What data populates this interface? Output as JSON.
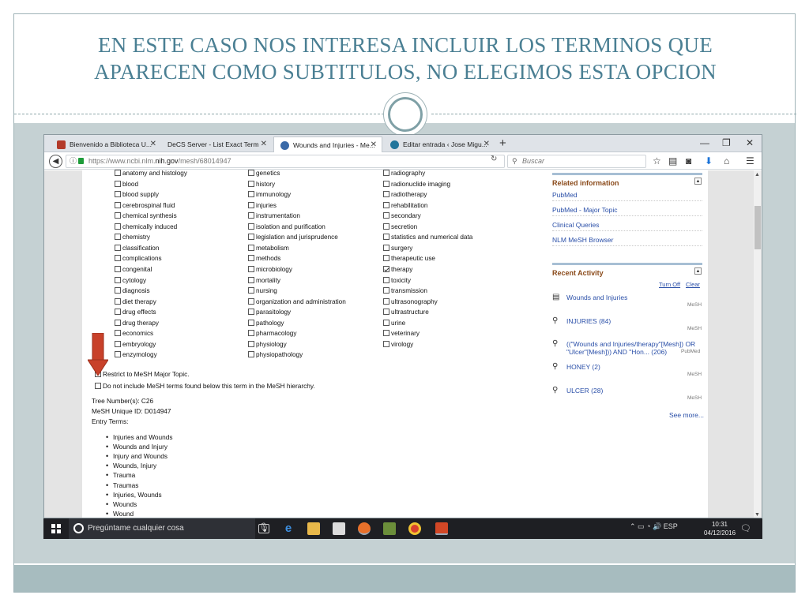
{
  "slide": {
    "title_line1": "EN ESTE CASO NOS INTERESA INCLUIR LOS TERMINOS QUE",
    "title_line2": "APARECEN COMO SUBTITULOS, NO ELEGIMOS ESTA OPCION"
  },
  "browser": {
    "tabs": [
      {
        "label": "Bienvenido a Biblioteca U...",
        "icon": "library-favicon",
        "color": "#b33a2a"
      },
      {
        "label": "DeCS Server - List Exact Term",
        "icon": "decs-favicon",
        "color": "#dfe3e8"
      },
      {
        "label": "Wounds and Injuries - Me...",
        "icon": "ncbi-favicon",
        "color": "#3a6aa8"
      },
      {
        "label": "Editar entrada ‹ Jose Migu...",
        "icon": "wordpress-favicon",
        "color": "#21759b"
      }
    ],
    "new_tab": "+",
    "url_prefix": "https://www.ncbi.nlm.",
    "url_domain": "nih.gov",
    "url_path": "/mesh/68014947",
    "search_placeholder": "Buscar"
  },
  "subheadings": {
    "col1": [
      {
        "label": "anatomy and histology",
        "checked": false
      },
      {
        "label": "blood",
        "checked": false
      },
      {
        "label": "blood supply",
        "checked": false
      },
      {
        "label": "cerebrospinal fluid",
        "checked": false
      },
      {
        "label": "chemical synthesis",
        "checked": false
      },
      {
        "label": "chemically induced",
        "checked": false
      },
      {
        "label": "chemistry",
        "checked": false
      },
      {
        "label": "classification",
        "checked": false
      },
      {
        "label": "complications",
        "checked": false
      },
      {
        "label": "congenital",
        "checked": false
      },
      {
        "label": "cytology",
        "checked": false
      },
      {
        "label": "diagnosis",
        "checked": false
      },
      {
        "label": "diet therapy",
        "checked": false
      },
      {
        "label": "drug effects",
        "checked": false
      },
      {
        "label": "drug therapy",
        "checked": false
      },
      {
        "label": "economics",
        "checked": false
      },
      {
        "label": "embryology",
        "checked": false
      },
      {
        "label": "enzymology",
        "checked": false
      }
    ],
    "col2": [
      {
        "label": "genetics",
        "checked": false
      },
      {
        "label": "history",
        "checked": false
      },
      {
        "label": "immunology",
        "checked": false
      },
      {
        "label": "injuries",
        "checked": false
      },
      {
        "label": "instrumentation",
        "checked": false
      },
      {
        "label": "isolation and purification",
        "checked": false
      },
      {
        "label": "legislation and jurisprudence",
        "checked": false
      },
      {
        "label": "metabolism",
        "checked": false
      },
      {
        "label": "methods",
        "checked": false
      },
      {
        "label": "microbiology",
        "checked": false
      },
      {
        "label": "mortality",
        "checked": false
      },
      {
        "label": "nursing",
        "checked": false
      },
      {
        "label": "organization and administration",
        "checked": false
      },
      {
        "label": "parasitology",
        "checked": false
      },
      {
        "label": "pathology",
        "checked": false
      },
      {
        "label": "pharmacology",
        "checked": false
      },
      {
        "label": "physiology",
        "checked": false
      },
      {
        "label": "physiopathology",
        "checked": false
      }
    ],
    "col3": [
      {
        "label": "radiography",
        "checked": false
      },
      {
        "label": "radionuclide imaging",
        "checked": false
      },
      {
        "label": "radiotherapy",
        "checked": false
      },
      {
        "label": "rehabilitation",
        "checked": false
      },
      {
        "label": "secondary",
        "checked": false
      },
      {
        "label": "secretion",
        "checked": false
      },
      {
        "label": "statistics and numerical data",
        "checked": false
      },
      {
        "label": "surgery",
        "checked": false
      },
      {
        "label": "therapeutic use",
        "checked": false
      },
      {
        "label": "therapy",
        "checked": true
      },
      {
        "label": "toxicity",
        "checked": false
      },
      {
        "label": "transmission",
        "checked": false
      },
      {
        "label": "ultrasonography",
        "checked": false
      },
      {
        "label": "ultrastructure",
        "checked": false
      },
      {
        "label": "urine",
        "checked": false
      },
      {
        "label": "veterinary",
        "checked": false
      },
      {
        "label": "virology",
        "checked": false
      }
    ]
  },
  "options": {
    "restrict_major": "Restrict to MeSH Major Topic.",
    "do_not_include": "Do not include MeSH terms found below this term in the MeSH hierarchy."
  },
  "term_info": {
    "tree_number": "Tree Number(s): C26",
    "unique_id": "MeSH Unique ID: D014947",
    "entry_terms_label": "Entry Terms:",
    "entry_terms": [
      "Injuries and Wounds",
      "Wounds and Injury",
      "Injury and Wounds",
      "Wounds, Injury",
      "Trauma",
      "Traumas",
      "Injuries, Wounds",
      "Wounds",
      "Wound"
    ]
  },
  "sidebar": {
    "related_title": "Related information",
    "related_links": [
      "PubMed",
      "PubMed - Major Topic",
      "Clinical Queries",
      "NLM MeSH Browser"
    ],
    "recent_title": "Recent Activity",
    "turn_off": "Turn Off",
    "clear": "Clear",
    "activities": [
      {
        "icon": "document-icon",
        "text1": "Wounds and Injuries",
        "text2": "",
        "tag": "MeSH"
      },
      {
        "icon": "search-icon",
        "text1": "INJURIES (84)",
        "text2": "",
        "tag": "MeSH"
      },
      {
        "icon": "search-icon",
        "text1": "((\"Wounds and Injuries/therapy\"[Mesh]) OR",
        "text2": "\"Ulcer\"[Mesh])) AND \"Hon... (206)",
        "tag": "PubMed"
      },
      {
        "icon": "search-icon",
        "text1": "HONEY (2)",
        "text2": "",
        "tag": "MeSH"
      },
      {
        "icon": "search-icon",
        "text1": "ULCER (28)",
        "text2": "",
        "tag": "MeSH"
      }
    ],
    "see_more": "See more..."
  },
  "taskbar": {
    "search_text": "Pregúntame cualquier cosa",
    "lang": "ESP",
    "time": "10:31",
    "date": "04/12/2016"
  }
}
